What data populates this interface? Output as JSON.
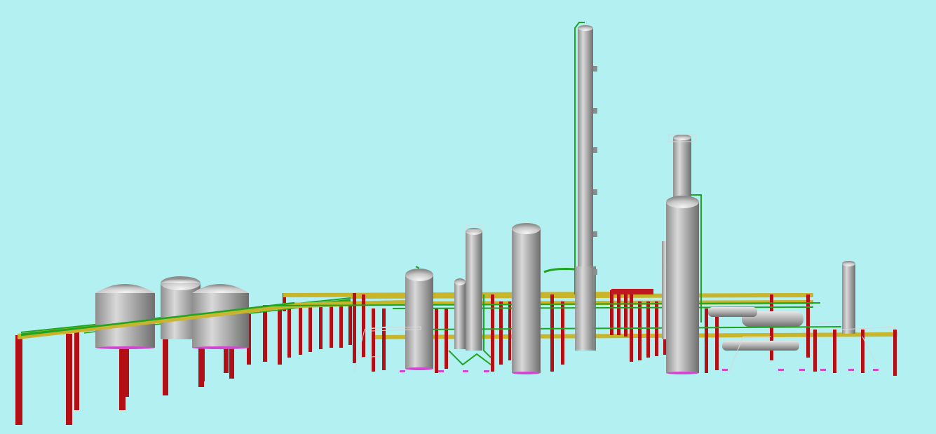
{
  "scene": {
    "kind": "3D plant model viewport",
    "colors": {
      "background": "#b3f0f2",
      "steel_support": "#b30f14",
      "pipe_rack_beam": "#c9b52a",
      "pipe_green": "#1fa51f",
      "vessel": "#a9aaa9",
      "vessel_highlight": "#e6e6e6",
      "vessel_shadow": "#6f6f6f",
      "foundation_magenta": "#d246d2",
      "railing": "#d8d8d8"
    },
    "equipment": [
      {
        "name": "storage-tank-1"
      },
      {
        "name": "storage-tank-2"
      },
      {
        "name": "storage-tank-3"
      },
      {
        "name": "tall-distillation-column"
      },
      {
        "name": "twin-column-large"
      },
      {
        "name": "twin-column-upper"
      },
      {
        "name": "vessel-mid-tall"
      },
      {
        "name": "vessel-left-short"
      },
      {
        "name": "vessel-small-column"
      },
      {
        "name": "small-column-right"
      },
      {
        "name": "horizontal-drum"
      }
    ]
  }
}
